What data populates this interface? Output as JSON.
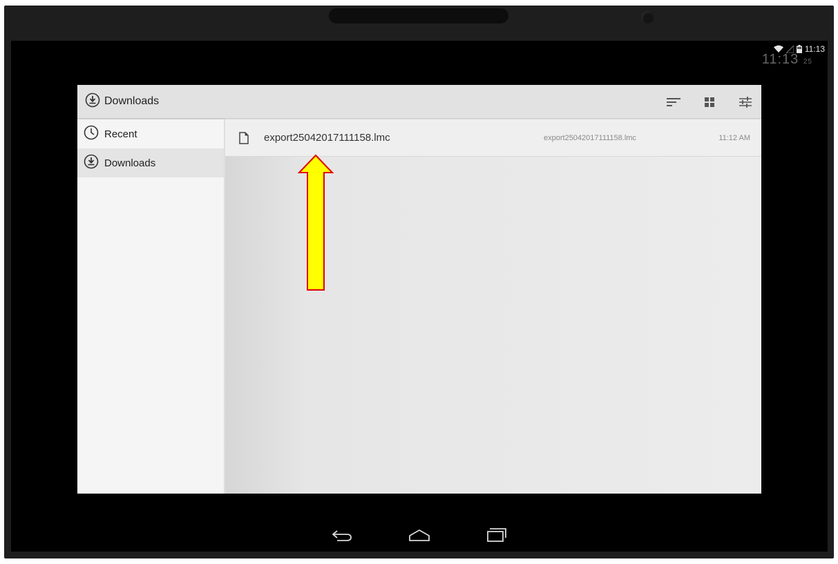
{
  "status_bar": {
    "time": "11:13"
  },
  "ghost_clock": {
    "time": "11:13",
    "seconds": "25"
  },
  "header": {
    "title": "Downloads",
    "icon": "download-icon",
    "actions": [
      "sort-icon",
      "grid-view-icon",
      "settings-sliders-icon"
    ]
  },
  "sidebar": {
    "items": [
      {
        "label": "Recent",
        "icon": "clock-icon",
        "active": false
      },
      {
        "label": "Downloads",
        "icon": "download-icon",
        "active": true
      }
    ]
  },
  "files": [
    {
      "name": "export25042017111158.lmc",
      "summary": "export25042017111158.lmc",
      "date": "11:12 AM",
      "icon": "file-icon"
    }
  ],
  "annotation": {
    "arrow_color": "#ffff00",
    "arrow_outline": "#e00000"
  },
  "navbar": {
    "buttons": [
      "back-icon",
      "home-icon",
      "recent-apps-icon"
    ]
  }
}
